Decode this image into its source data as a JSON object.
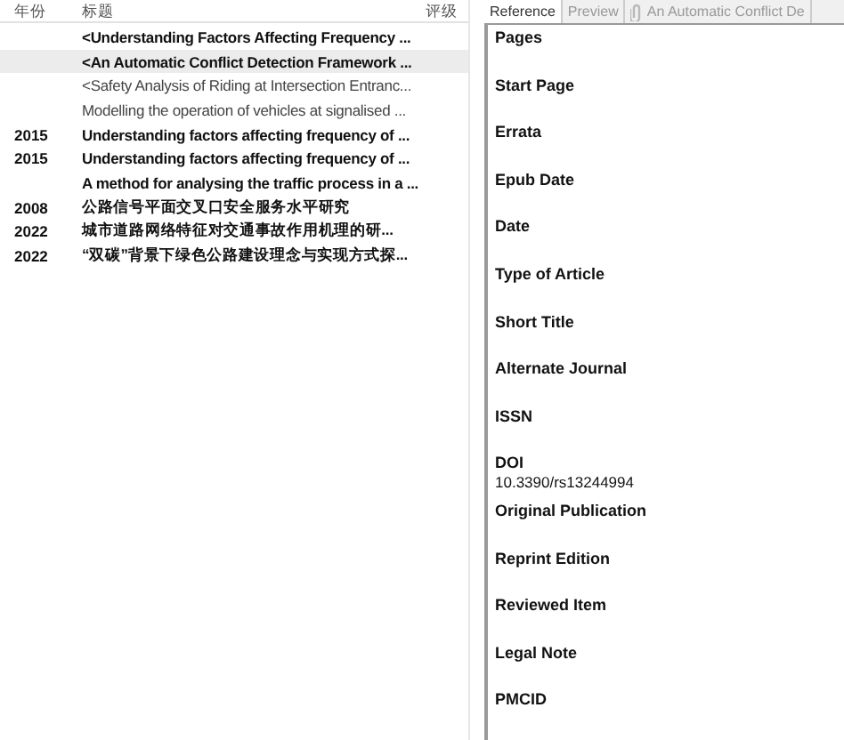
{
  "table": {
    "columns": [
      "年份",
      "标题",
      "评级"
    ],
    "rows": [
      {
        "year": "",
        "title": "<Understanding Factors Affecting Frequency ...",
        "unread": true,
        "selected": false
      },
      {
        "year": "",
        "title": "<An Automatic Conflict Detection Framework ...",
        "unread": true,
        "selected": true
      },
      {
        "year": "",
        "title": "<Safety Analysis of Riding at Intersection Entranc...",
        "unread": false,
        "selected": false
      },
      {
        "year": "",
        "title": "Modelling the operation of vehicles at signalised ...",
        "unread": false,
        "selected": false
      },
      {
        "year": "2015",
        "title": "Understanding factors affecting frequency of ...",
        "unread": true,
        "selected": false
      },
      {
        "year": "2015",
        "title": "Understanding factors affecting frequency of ...",
        "unread": true,
        "selected": false
      },
      {
        "year": "",
        "title": "A method for analysing the traffic process in a ...",
        "unread": true,
        "selected": false
      },
      {
        "year": "2008",
        "title": "公路信号平面交叉口安全服务水平研究",
        "unread": true,
        "selected": false
      },
      {
        "year": "2022",
        "title": "城市道路网络特征对交通事故作用机理的研...",
        "unread": true,
        "selected": false
      },
      {
        "year": "2022",
        "title": "“双碳”背景下绿色公路建设理念与实现方式探...",
        "unread": true,
        "selected": false
      }
    ]
  },
  "tabs": [
    {
      "label": "Reference",
      "selected": true,
      "kind": "plain"
    },
    {
      "label": "Preview",
      "selected": false,
      "kind": "plain"
    },
    {
      "label": "An Automatic Conflict De",
      "selected": false,
      "kind": "attachment"
    }
  ],
  "fields": [
    {
      "label": "Pages"
    },
    {
      "label": "Start Page"
    },
    {
      "label": "Errata"
    },
    {
      "label": "Epub Date"
    },
    {
      "label": "Date"
    },
    {
      "label": "Type of Article"
    },
    {
      "label": "Short Title"
    },
    {
      "label": "Alternate Journal"
    },
    {
      "label": "ISSN"
    },
    {
      "label": "DOI",
      "value": "10.3390/rs13244994"
    },
    {
      "label": "Original Publication"
    },
    {
      "label": "Reprint Edition"
    },
    {
      "label": "Reviewed Item"
    },
    {
      "label": "Legal Note"
    },
    {
      "label": "PMCID"
    }
  ]
}
